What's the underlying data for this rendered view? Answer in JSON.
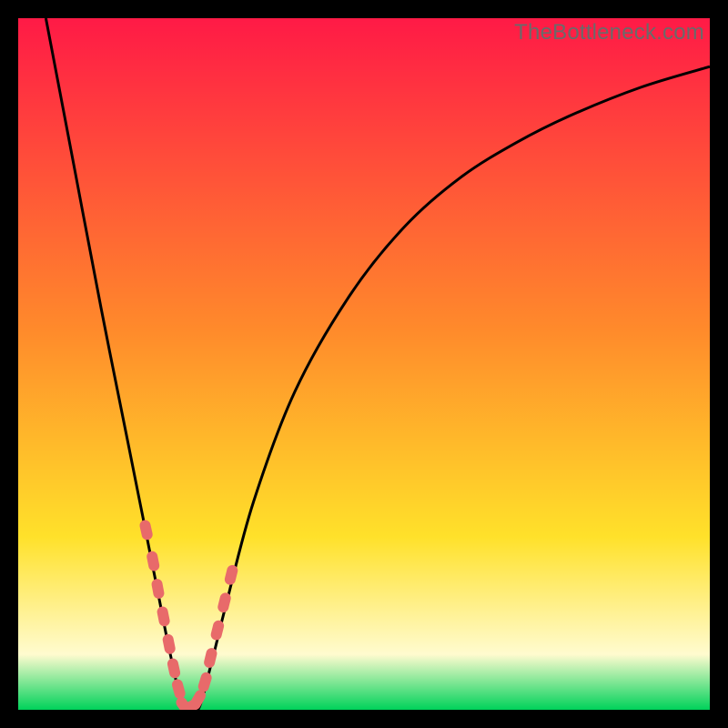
{
  "watermark": "TheBottleneck.com",
  "colors": {
    "bg_black": "#000000",
    "gradient_top": "#ff1a46",
    "gradient_mid1": "#ff8a2b",
    "gradient_mid2": "#ffe12a",
    "gradient_low": "#fffbcf",
    "gradient_bottom": "#00d25a",
    "curve": "#000000",
    "marker": "#e86a6a"
  },
  "chart_data": {
    "type": "line",
    "title": "",
    "xlabel": "",
    "ylabel": "",
    "xlim": [
      0,
      100
    ],
    "ylim": [
      0,
      100
    ],
    "curve_description": "V-shaped bottleneck curve reaching 0 near x≈24, rising steeply on both sides",
    "series": [
      {
        "name": "bottleneck-curve",
        "x": [
          4,
          8,
          12,
          16,
          18,
          20,
          22,
          24,
          26,
          28,
          30,
          34,
          40,
          48,
          56,
          64,
          72,
          80,
          90,
          100
        ],
        "values": [
          100,
          79,
          58,
          38,
          28,
          18,
          8,
          0,
          0,
          7,
          15,
          30,
          46,
          60,
          70,
          77,
          82,
          86,
          90,
          93
        ]
      }
    ],
    "markers": {
      "name": "highlighted-points",
      "x": [
        18.5,
        19.5,
        20.2,
        21.0,
        21.8,
        22.5,
        23.2,
        24.0,
        25.0,
        26.0,
        27.0,
        27.8,
        28.8,
        29.8,
        30.8
      ],
      "y": [
        26.0,
        21.5,
        17.5,
        13.5,
        9.5,
        6.0,
        3.0,
        0.5,
        0.5,
        1.5,
        4.0,
        7.5,
        11.5,
        15.5,
        19.5
      ]
    },
    "gradient_stops": [
      {
        "offset": 0.0,
        "key": "gradient_top"
      },
      {
        "offset": 0.45,
        "key": "gradient_mid1"
      },
      {
        "offset": 0.75,
        "key": "gradient_mid2"
      },
      {
        "offset": 0.92,
        "key": "gradient_low"
      },
      {
        "offset": 1.0,
        "key": "gradient_bottom"
      }
    ]
  }
}
